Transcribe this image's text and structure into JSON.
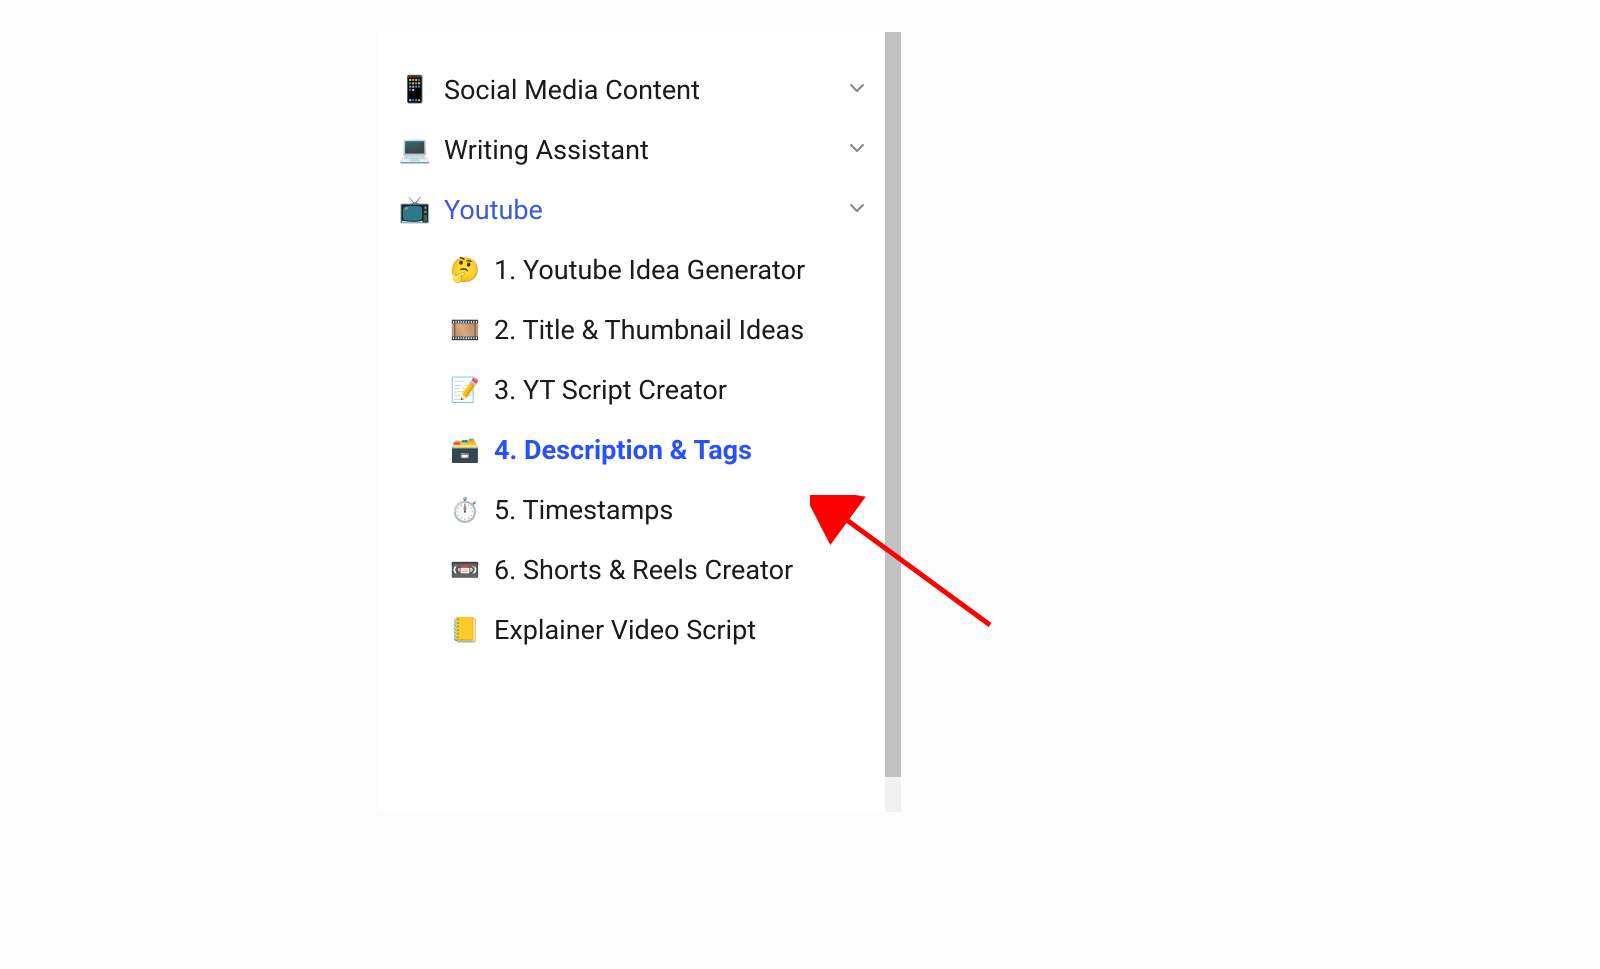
{
  "sidebar": {
    "categories": [
      {
        "icon": "📱",
        "label": "Social Media Content",
        "expanded": false,
        "active": false
      },
      {
        "icon": "💻",
        "label": "Writing Assistant",
        "expanded": false,
        "active": false
      },
      {
        "icon": "📺",
        "label": "Youtube",
        "expanded": true,
        "active": true,
        "items": [
          {
            "icon": "🤔",
            "label": "1. Youtube Idea Generator",
            "selected": false
          },
          {
            "icon": "🎞️",
            "label": "2. Title & Thumbnail Ideas",
            "selected": false
          },
          {
            "icon": "📝",
            "label": "3. YT Script Creator",
            "selected": false
          },
          {
            "icon": "🗃️",
            "label": "4. Description & Tags",
            "selected": true
          },
          {
            "icon": "⏱️",
            "label": "5. Timestamps",
            "selected": false
          },
          {
            "icon": "📼",
            "label": "6. Shorts & Reels Creator",
            "selected": false
          },
          {
            "icon": "📒",
            "label": "Explainer Video Script",
            "selected": false
          }
        ]
      }
    ]
  },
  "annotation": {
    "type": "arrow",
    "color": "#ff0000",
    "target": "4. Description & Tags"
  }
}
